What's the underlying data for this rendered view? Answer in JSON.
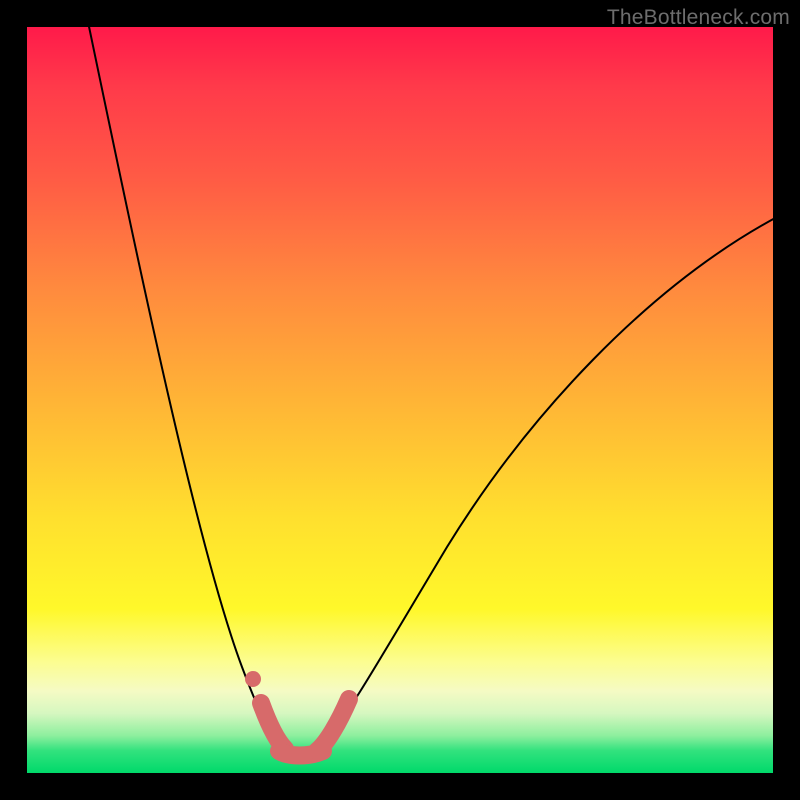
{
  "watermark": "TheBottleneck.com",
  "chart_data": {
    "type": "line",
    "title": "",
    "xlabel": "",
    "ylabel": "",
    "xlim": [
      0,
      100
    ],
    "ylim": [
      0,
      100
    ],
    "grid": false,
    "legend": false,
    "series": [
      {
        "name": "bottleneck-curve",
        "x": [
          5,
          10,
          15,
          20,
          25,
          28,
          30,
          32,
          34,
          36,
          38,
          40,
          45,
          50,
          55,
          60,
          70,
          80,
          90,
          100
        ],
        "y": [
          100,
          80,
          60,
          40,
          20,
          10,
          5,
          2,
          1,
          1,
          2,
          5,
          12,
          22,
          32,
          40,
          54,
          64,
          72,
          79
        ]
      }
    ],
    "highlight_band": {
      "name": "optimal-region",
      "x_range": [
        30,
        40
      ],
      "y_approx": 1
    },
    "background": {
      "type": "vertical-gradient",
      "stops": [
        {
          "pos": 0.0,
          "color": "#ff1a4a"
        },
        {
          "pos": 0.5,
          "color": "#ffb436"
        },
        {
          "pos": 0.78,
          "color": "#fff82a"
        },
        {
          "pos": 1.0,
          "color": "#00d96a"
        }
      ]
    }
  }
}
